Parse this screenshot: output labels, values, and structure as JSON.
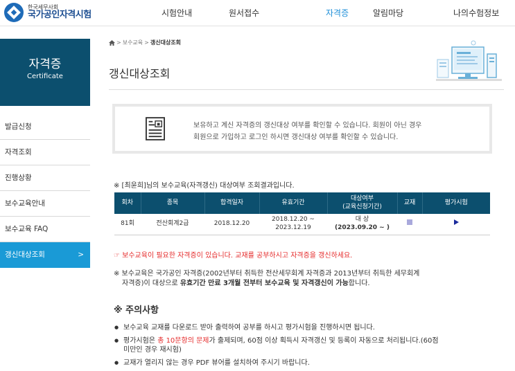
{
  "header": {
    "logo_sub": "한국세무사회",
    "logo_main": "국가공인자격시험",
    "nav": [
      "시험안내",
      "원서접수",
      "자격증",
      "알림마당",
      "나의수험정보"
    ],
    "nav_active_index": 2
  },
  "sidebar": {
    "title": "자격증",
    "subtitle": "Certificate",
    "items": [
      {
        "label": "발급신청"
      },
      {
        "label": "자격조회"
      },
      {
        "label": "진행상황"
      },
      {
        "label": "보수교육안내"
      },
      {
        "label": "보수교육 FAQ"
      },
      {
        "label": "갱신대상조회",
        "arrow": ">"
      }
    ],
    "active_index": 5
  },
  "breadcrumb": {
    "sep": ">",
    "parent": "보수교육",
    "current": "갱신대상조회"
  },
  "page": {
    "title": "갱신대상조회",
    "info_line1": "보유하고 계신 자격증의 갱신대상 여부를 확인할 수 있습니다. 회원이 아닌 경우",
    "info_line2": "회원으로 가입하고 로그인 하시면 갱신대상 여부를 확인할 수 있습니다.",
    "result_caption": "※ [최윤희]님의 보수교육(자격갱신) 대상여부 조회결과입니다."
  },
  "table": {
    "headers": [
      "회차",
      "종목",
      "합격일자",
      "유효기간",
      "대상여부",
      "교재",
      "평가시험"
    ],
    "header_target_sub": "(교육신청기간)",
    "rows": [
      {
        "round": "81회",
        "item": "전산회계2급",
        "pass_date": "2018.12.20",
        "valid_from": "2018.12.20 ~",
        "valid_to": "2023.12.19",
        "target": "대 상",
        "apply_period": "(2023.09.20 ~ )"
      }
    ]
  },
  "notices": {
    "alert": "☞ 보수교육이 필요한 자격증이 있습니다. 교재를 공부하시고 자격증을 갱신하세요.",
    "note_line1": "※ 보수교육은 국가공인 자격증(2002년부터 취득한 전산세무회계 자격증과 2013년부터 취득한 세무회계",
    "note_line2_a": "자격증)이 대상으로 ",
    "note_line2_b": "유효기간 만료 3개월 전부터 보수교육 및 자격갱신이 가능",
    "note_line2_c": "합니다.",
    "caution_title": "※ 주의사항",
    "caution_1": "보수교육 교재를 다운로드 받아 출력하여 공부를 하시고 평가시험을 진행하시면 됩니다.",
    "caution_2_a": "평가시험은 ",
    "caution_2_b": "총 10문항의 문제",
    "caution_2_c": "가 출제되며, 60점 이상 획득시 자격갱신 및 등록이 자동으로 처리됩니다.(60점",
    "caution_2_d": "미만인 경우 재시험)",
    "caution_3": "교재가 열리지 않는 경우 PDF 뷰어를 설치하여 주시기 바랍니다."
  },
  "colors": {
    "nav_active": "#1e8fd8",
    "sidebar_head": "#0c4f6e",
    "sidebar_active": "#1a9ad6",
    "table_head": "#0c4f6e",
    "alert": "#e52a2a"
  }
}
